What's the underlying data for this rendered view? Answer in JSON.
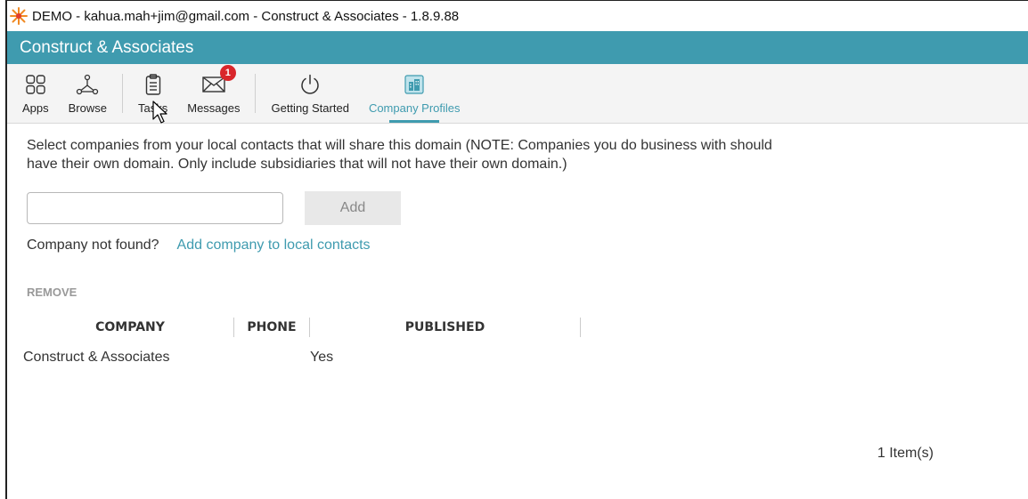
{
  "window": {
    "title": "DEMO - kahua.mah+jim@gmail.com - Construct & Associates - 1.8.9.88"
  },
  "appbar": {
    "title": "Construct & Associates"
  },
  "toolbar": {
    "items": [
      {
        "label": "Apps",
        "icon": "apps-grid-icon"
      },
      {
        "label": "Browse",
        "icon": "browse-network-icon"
      },
      {
        "label": "Tasks",
        "icon": "clipboard-icon"
      },
      {
        "label": "Messages",
        "icon": "envelope-icon",
        "badge": "1"
      },
      {
        "label": "Getting Started",
        "icon": "power-icon"
      },
      {
        "label": "Company Profiles",
        "icon": "building-icon",
        "active": true
      }
    ]
  },
  "main": {
    "instructions": "Select companies from your local contacts that will share this domain (NOTE: Companies you do business with should have their own domain.  Only include subsidiaries that will not have their own domain.)",
    "search": {
      "value": "",
      "placeholder": ""
    },
    "add_label": "Add",
    "not_found_text": "Company not found?",
    "add_contact_link": "Add company to local contacts",
    "remove_label": "REMOVE",
    "table": {
      "columns": [
        "COMPANY",
        "PHONE",
        "PUBLISHED"
      ],
      "rows": [
        {
          "company": "Construct & Associates",
          "phone": "",
          "published": "Yes"
        }
      ]
    },
    "item_count": "1 Item(s)"
  },
  "colors": {
    "accent": "#3f9baf",
    "badge": "#d9262b"
  }
}
